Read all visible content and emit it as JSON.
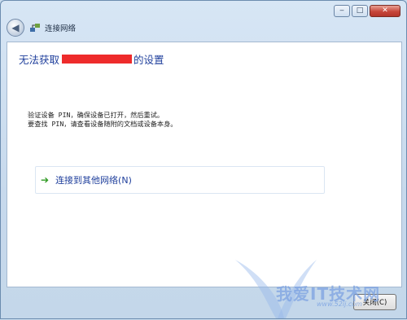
{
  "window": {
    "title": "连接网络",
    "controls": {
      "minimize": "‒",
      "maximize": "□",
      "close": "✕"
    }
  },
  "icons": {
    "back": "back-arrow-icon",
    "app": "network-icon",
    "option": "green-arrow-icon"
  },
  "content": {
    "heading_prefix": "无法获取",
    "heading_suffix": "的设置",
    "message_line1": "验证设备 PIN，确保设备已打开，然后重试。",
    "message_line2": "要查找 PIN，请查看设备随附的文档或设备本身。",
    "option_label": "连接到其他网络(N)"
  },
  "footer": {
    "close_button": "关闭(C)"
  },
  "watermark": {
    "text": "我爱IT技术网",
    "url": "www.52ij.com"
  },
  "colors": {
    "heading": "#1f3f9c",
    "redaction": "#ee2b2b",
    "option_arrow": "#2f9a22"
  }
}
